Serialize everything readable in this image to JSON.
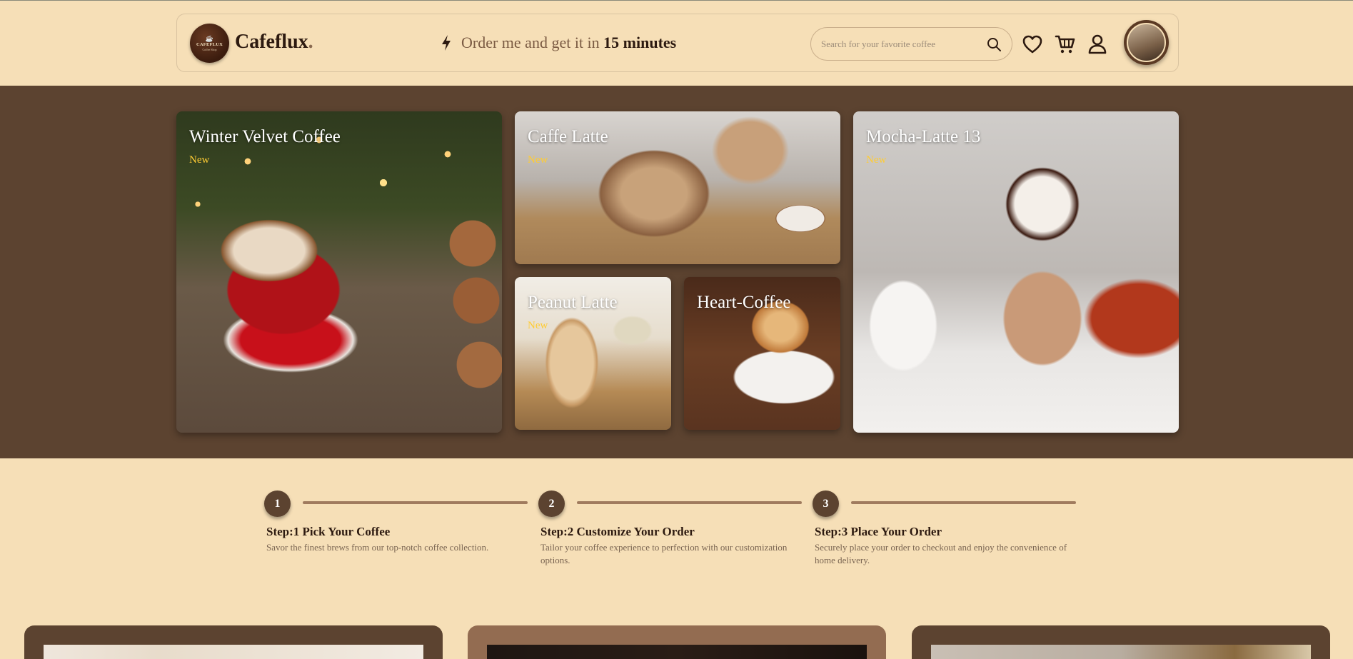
{
  "header": {
    "logo": {
      "text": "CAFEFLUX",
      "subtext": "Coffee Shop"
    },
    "brand": "Cafeflux",
    "brand_dot": ".",
    "promo_prefix": "Order me and get it in",
    "promo_time": "15 minutes",
    "search_placeholder": "Search for your favorite coffee",
    "icons": [
      "bolt-icon",
      "search-icon",
      "heart-icon",
      "cart-icon",
      "user-icon"
    ]
  },
  "hero": {
    "items": [
      {
        "title": "Winter Velvet Coffee",
        "badge": "New"
      },
      {
        "title": "Caffe Latte",
        "badge": "New"
      },
      {
        "title": "Peanut Latte",
        "badge": "New"
      },
      {
        "title": "Heart-Coffee",
        "badge": ""
      },
      {
        "title": "Mocha-Latte 13",
        "badge": "New"
      }
    ]
  },
  "steps": [
    {
      "number": "1",
      "title": "Step:1 Pick Your Coffee",
      "desc": "Savor the finest brews from our top-notch coffee collection."
    },
    {
      "number": "2",
      "title": "Step:2 Customize Your Order",
      "desc": "Tailor your coffee experience to perfection with our customization options."
    },
    {
      "number": "3",
      "title": "Step:3 Place Your Order",
      "desc": "Securely place your order to checkout and enjoy the convenience of home delivery."
    }
  ],
  "colors": {
    "background": "#f6dfb7",
    "hero_band": "#5c4330",
    "accent_badge": "#ffcc33",
    "dark_text": "#2d1a10"
  }
}
